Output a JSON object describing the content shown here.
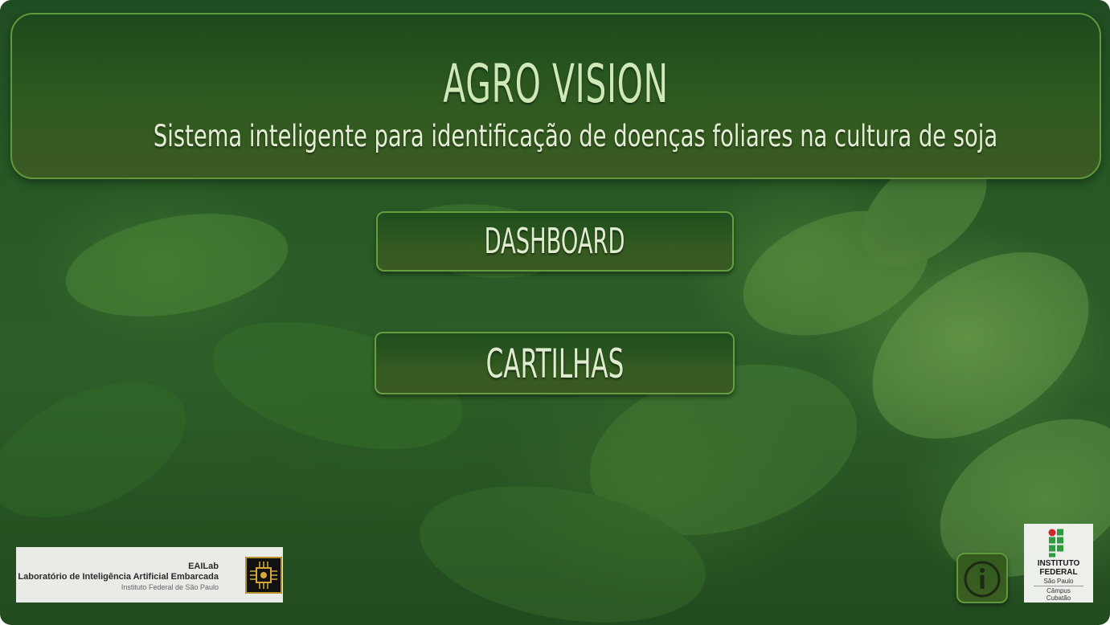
{
  "header": {
    "title": "AGRO VISION",
    "subtitle": "Sistema inteligente para identificação de doenças foliares na cultura de soja"
  },
  "menu": {
    "dashboard_label": "DASHBOARD",
    "cartilhas_label": "CARTILHAS"
  },
  "footer": {
    "eailab": {
      "name": "EAILab",
      "full_name": "Laboratório de Inteligência Artificial Embarcada",
      "institution": "Instituto Federal de São Paulo",
      "icon": "chip-icon"
    },
    "info_button": {
      "icon": "info-icon"
    },
    "ifsp": {
      "line1": "INSTITUTO",
      "line2": "FEDERAL",
      "line3": "São Paulo",
      "line4": "Câmpus",
      "line5": "Cubatão",
      "icon": "if-logo-icon"
    }
  },
  "colors": {
    "accent": "#5f9a3a",
    "title_text": "#cfe8b8",
    "ifsp_red": "#d4262a",
    "ifsp_green": "#2f9a41"
  }
}
